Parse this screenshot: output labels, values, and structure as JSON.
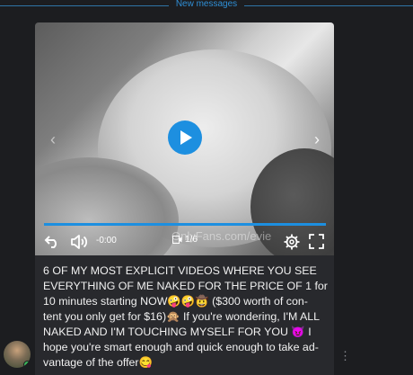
{
  "divider": {
    "label": "New messages"
  },
  "colors": {
    "accent": "#1d8fe0",
    "card": "#28292d",
    "background": "#1c1d20"
  },
  "video": {
    "time": "-0:00",
    "media_counter": "1/6",
    "watermark": "OnlyFans.com/evie",
    "progress": 1.0,
    "icons": [
      "chevron-left-icon",
      "chevron-right-icon",
      "play-icon",
      "rewind-icon",
      "volume-icon",
      "media-icon",
      "gear-icon",
      "fullscreen-icon"
    ]
  },
  "message": {
    "text": "6 OF MY MOST EXPLICIT VIDEOS WHERE YOU SEE\nEVERYTHING OF ME NAKED FOR THE PRICE OF 1 for\n10 minutes starting NOW🤪🤪🤠 ($300 worth of con-\ntent you only get for $16)🙊 If you're wondering, I'M ALL\nNAKED AND I'M TOUCHING MYSELF FOR YOU 😈 I\nhope you're smart enough and quick enough to take ad-\nvantage of the offer😋"
  },
  "more_icon": "⋮"
}
